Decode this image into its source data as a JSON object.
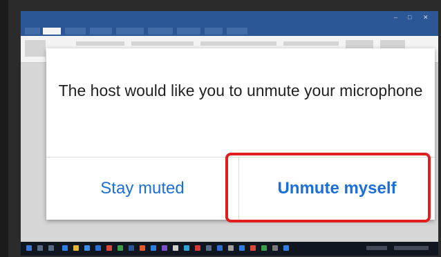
{
  "dialog": {
    "message": "The host would like you to unmute your microphone",
    "stay_muted_label": "Stay muted",
    "unmute_label": "Unmute myself"
  },
  "colors": {
    "button_text": "#1a6fd8",
    "highlight_border": "#e01e1e",
    "word_title_bar": "#2b5797",
    "taskbar": "#10161f"
  },
  "icons": {
    "taskbar": [
      "start-icon",
      "search-icon",
      "taskview-icon",
      "edge-icon",
      "explorer-icon",
      "store-icon",
      "mail-icon",
      "app-icon",
      "app-icon",
      "app-icon",
      "app-icon",
      "app-icon",
      "app-icon",
      "app-icon",
      "app-icon",
      "app-icon",
      "app-icon",
      "app-icon",
      "app-icon",
      "app-icon",
      "app-icon",
      "app-icon",
      "app-icon",
      "app-icon"
    ]
  }
}
